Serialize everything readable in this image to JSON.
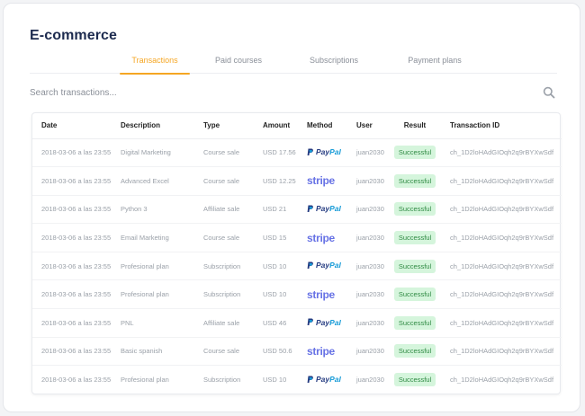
{
  "page": {
    "title": "E-commerce"
  },
  "tabs": [
    {
      "label": "Transactions",
      "active": true
    },
    {
      "label": "Paid courses",
      "active": false
    },
    {
      "label": "Subscriptions",
      "active": false
    },
    {
      "label": "Payment plans",
      "active": false
    }
  ],
  "search": {
    "placeholder": "Search transactions...",
    "value": "",
    "icon": "search-icon"
  },
  "table": {
    "headers": {
      "date": "Date",
      "description": "Description",
      "type": "Type",
      "amount": "Amount",
      "method": "Method",
      "user": "User",
      "result": "Result",
      "transaction_id": "Transaction ID"
    },
    "rows": [
      {
        "date": "2018-03-06 a las 23:55",
        "description": "Digital Marketing",
        "type": "Course sale",
        "amount": "USD 17.56",
        "method": "PayPal",
        "user": "juan2030",
        "result": "Successful",
        "transaction_id": "ch_1D2loHAdGIOqh2q9rBYXwSdf"
      },
      {
        "date": "2018-03-06 a las 23:55",
        "description": "Advanced Excel",
        "type": "Course sale",
        "amount": "USD 12.25",
        "method": "stripe",
        "user": "juan2030",
        "result": "Successful",
        "transaction_id": "ch_1D2loHAdGIOqh2q9rBYXwSdf"
      },
      {
        "date": "2018-03-06 a las 23:55",
        "description": "Python 3",
        "type": "Affiliate sale",
        "amount": "USD 21",
        "method": "PayPal",
        "user": "juan2030",
        "result": "Successful",
        "transaction_id": "ch_1D2loHAdGIOqh2q9rBYXwSdf"
      },
      {
        "date": "2018-03-06 a las 23:55",
        "description": "Email Marketing",
        "type": "Course sale",
        "amount": "USD 15",
        "method": "stripe",
        "user": "juan2030",
        "result": "Successful",
        "transaction_id": "ch_1D2loHAdGIOqh2q9rBYXwSdf"
      },
      {
        "date": "2018-03-06 a las 23:55",
        "description": "Profesional plan",
        "type": "Subscription",
        "amount": "USD 10",
        "method": "PayPal",
        "user": "juan2030",
        "result": "Successful",
        "transaction_id": "ch_1D2loHAdGIOqh2q9rBYXwSdf"
      },
      {
        "date": "2018-03-06 a las 23:55",
        "description": "Profesional plan",
        "type": "Subscription",
        "amount": "USD 10",
        "method": "stripe",
        "user": "juan2030",
        "result": "Successful",
        "transaction_id": "ch_1D2loHAdGIOqh2q9rBYXwSdf"
      },
      {
        "date": "2018-03-06 a las 23:55",
        "description": "PNL",
        "type": "Affiliate sale",
        "amount": "USD 46",
        "method": "PayPal",
        "user": "juan2030",
        "result": "Successful",
        "transaction_id": "ch_1D2loHAdGIOqh2q9rBYXwSdf"
      },
      {
        "date": "2018-03-06 a las 23:55",
        "description": "Basic spanish",
        "type": "Course sale",
        "amount": "USD 50.6",
        "method": "stripe",
        "user": "juan2030",
        "result": "Successful",
        "transaction_id": "ch_1D2loHAdGIOqh2q9rBYXwSdf"
      },
      {
        "date": "2018-03-06 a las 23:55",
        "description": "Profesional plan",
        "type": "Subscription",
        "amount": "USD 10",
        "method": "PayPal",
        "user": "juan2030",
        "result": "Successful",
        "transaction_id": "ch_1D2loHAdGIOqh2q9rBYXwSdf"
      }
    ]
  },
  "colors": {
    "accent": "#f5a623",
    "title": "#1d2b4f",
    "success_bg": "#d5f5dc",
    "success_text": "#2f8a43",
    "paypal_dark": "#253b80",
    "paypal_light": "#179bd7",
    "stripe": "#6772e5"
  }
}
